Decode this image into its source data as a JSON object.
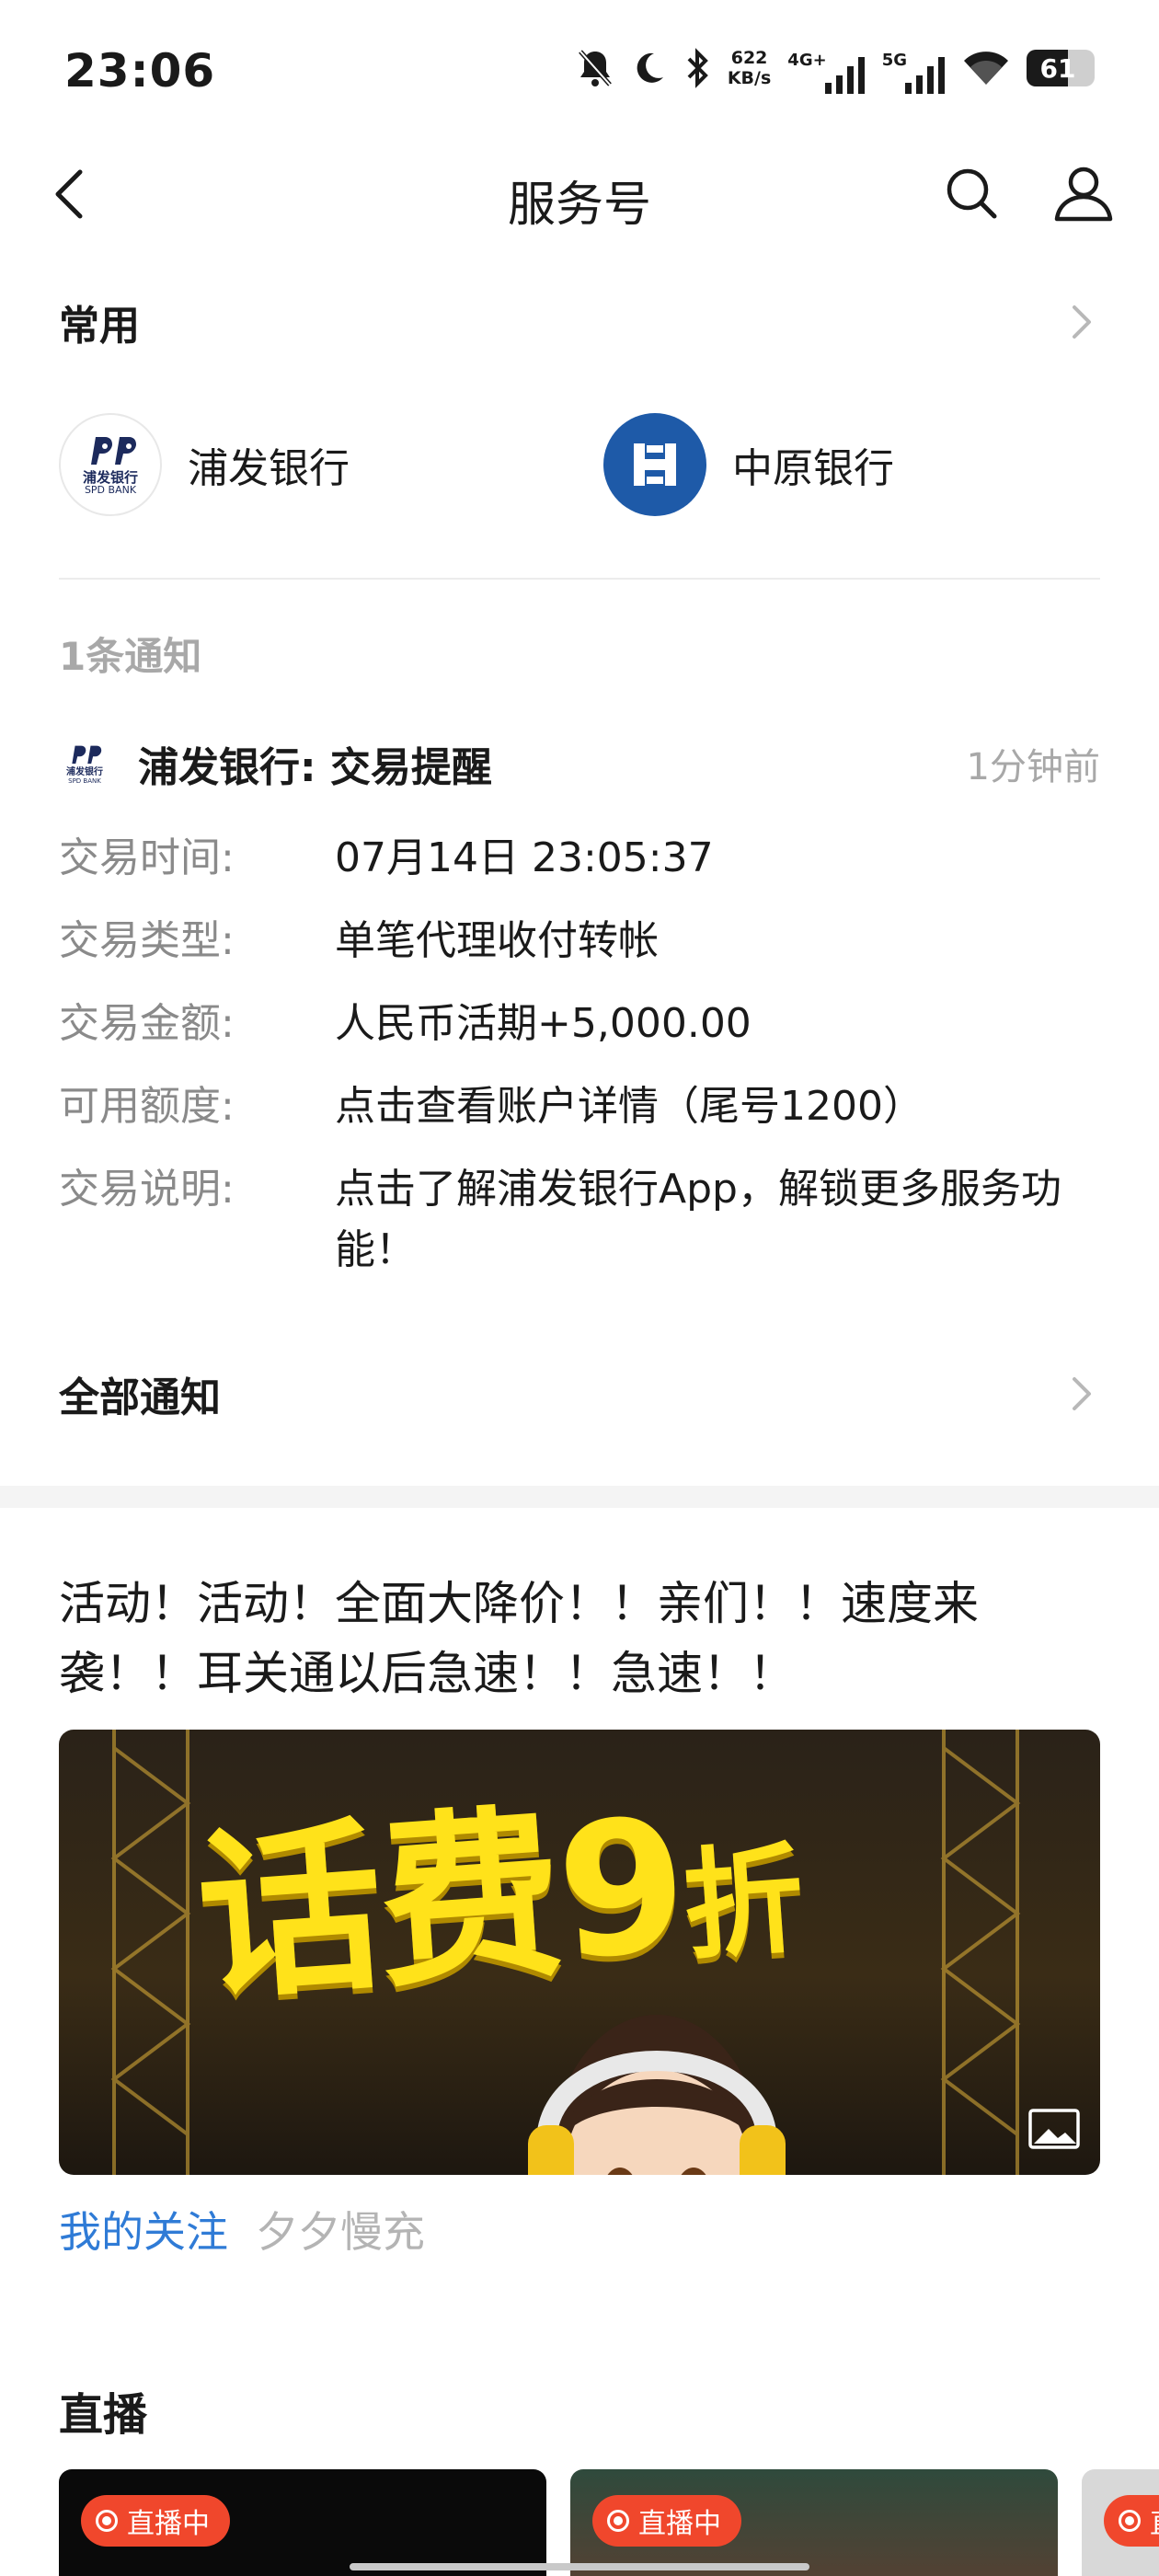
{
  "status_bar": {
    "time": "23:06",
    "net_speed_value": "622",
    "net_speed_unit": "KB/s",
    "sig1_label": "4G+",
    "sig2_label": "5G",
    "battery": "61",
    "battery_level": 0.61
  },
  "nav": {
    "title": "服务号"
  },
  "common": {
    "title": "常用",
    "accounts": [
      {
        "name": "浦发银行",
        "logo_sub": "浦发银行",
        "logo_sub2": "SPD BANK"
      },
      {
        "name": "中原银行"
      }
    ]
  },
  "notification": {
    "count_label": "1条通知",
    "sender": "浦发银行: 交易提醒",
    "logo_sub": "浦发银行",
    "logo_sub2": "SPD BANK",
    "time_ago": "1分钟前",
    "rows": [
      {
        "label": "交易时间:",
        "value": "07月14日  23:05:37"
      },
      {
        "label": "交易类型:",
        "value": "单笔代理收付转帐"
      },
      {
        "label": "交易金额:",
        "value": "人民币活期+5,000.00"
      },
      {
        "label": "可用额度:",
        "value": "点击查看账户详情（尾号1200）"
      },
      {
        "label": "交易说明:",
        "value": "点击了解浦发银行App，解锁更多服务功能！"
      }
    ],
    "all_label": "全部通知"
  },
  "promo": {
    "text": "活动！活动！全面大降价！！亲们！！速度来袭！！耳关通以后急速！！急速！！",
    "banner_main": "话费9",
    "banner_small": "折",
    "tag_following": "我的关注",
    "tag_author": "夕夕慢充"
  },
  "live": {
    "title": "直播",
    "badge": "直播中"
  },
  "colors": {
    "accent_blue": "#2f7bd6",
    "live_red": "#f0472c",
    "banner_yellow": "#ffe21a",
    "zhongyuan_blue": "#1e5aa8"
  }
}
